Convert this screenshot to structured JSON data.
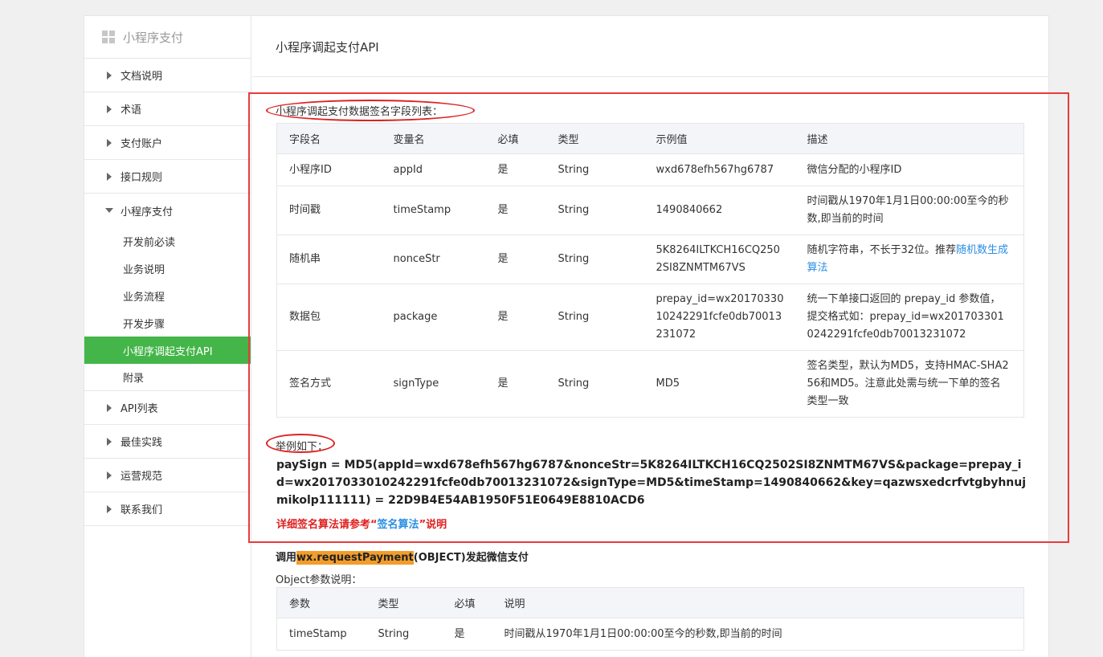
{
  "sidebar": {
    "title": "小程序支付",
    "items_top": [
      "文档说明",
      "术语",
      "支付账户",
      "接口规则"
    ],
    "open_group": "小程序支付",
    "sub_items": [
      "开发前必读",
      "业务说明",
      "业务流程",
      "开发步骤",
      "小程序调起支付API",
      "附录"
    ],
    "active_sub": "小程序调起支付API",
    "items_bottom": [
      "API列表",
      "最佳实践",
      "运营规范",
      "联系我们"
    ]
  },
  "main": {
    "title": "小程序调起支付API",
    "sign_table_label": "小程序调起支付数据签名字段列表：",
    "sign_table": {
      "headers": [
        "字段名",
        "变量名",
        "必填",
        "类型",
        "示例值",
        "描述"
      ],
      "rows": [
        [
          "小程序ID",
          "appId",
          "是",
          "String",
          "wxd678efh567hg6787",
          "微信分配的小程序ID"
        ],
        [
          "时间戳",
          "timeStamp",
          "是",
          "String",
          "1490840662",
          "时间戳从1970年1月1日00:00:00至今的秒数,即当前的时间"
        ],
        [
          "随机串",
          "nonceStr",
          "是",
          "String",
          "5K8264ILTKCH16CQ2502SI8ZNMTM67VS",
          "随机字符串，不长于32位。推荐"
        ],
        [
          "数据包",
          "package",
          "是",
          "String",
          "prepay_id=wx2017033010242291fcfe0db70013231072",
          "统一下单接口返回的 prepay_id 参数值，提交格式如：prepay_id=wx2017033010242291fcfe0db70013231072"
        ],
        [
          "签名方式",
          "signType",
          "是",
          "String",
          "MD5",
          "签名类型，默认为MD5，支持HMAC-SHA256和MD5。注意此处需与统一下单的签名类型一致"
        ]
      ],
      "nonce_link": "随机数生成算法"
    },
    "example_label": "举例如下：",
    "example_code": "paySign = MD5(appId=wxd678efh567hg6787&nonceStr=5K8264ILTKCH16CQ2502SI8ZNMTM67VS&package=prepay_id=wx2017033010242291fcfe0db70013231072&signType=MD5&timeStamp=1490840662&key=qazwsxedcrfvtgbyhnujmikolp111111) = 22D9B4E54AB1950F51E0649E8810ACD6",
    "note_prefix": "详细签名算法请参考“",
    "note_link": "签名算法",
    "note_suffix": "”说明",
    "call_prefix": "调用",
    "call_highlight": "wx.requestPayment",
    "call_suffix": "(OBJECT)发起微信支付",
    "object_label": "Object参数说明：",
    "object_table": {
      "headers": [
        "参数",
        "类型",
        "必填",
        "说明"
      ],
      "rows": [
        [
          "timeStamp",
          "String",
          "是",
          "时间戳从1970年1月1日00:00:00至今的秒数,即当前的时间"
        ]
      ]
    }
  },
  "colors": {
    "active_green": "#44b549",
    "annotation_red": "#e83b3b",
    "link_blue": "#2a8ee5",
    "highlight_orange": "#f29d2a"
  }
}
